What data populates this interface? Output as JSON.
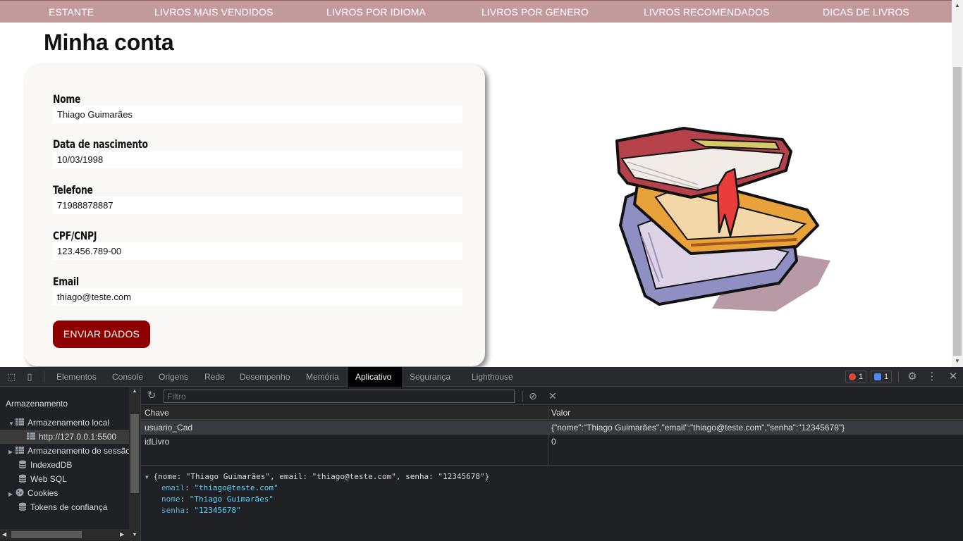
{
  "nav": {
    "items": [
      "ESTANTE",
      "LIVROS MAIS VENDIDOS",
      "LIVROS POR IDIOMA",
      "LIVROS POR GENERO",
      "LIVROS RECOMENDADOS",
      "DICAS DE LIVROS"
    ]
  },
  "page": {
    "title": "Minha conta"
  },
  "form": {
    "fields": [
      {
        "label": "Nome",
        "value": "Thiago Guimarães"
      },
      {
        "label": "Data de nascimento",
        "value": "10/03/1998"
      },
      {
        "label": "Telefone",
        "value": "71988878887"
      },
      {
        "label": "CPF/CNPJ",
        "value": "123.456.789-00"
      },
      {
        "label": "Email",
        "value": "thiago@teste.com"
      }
    ],
    "submit_label": "ENVIAR DADOS"
  },
  "devtools": {
    "tabs": [
      "Elementos",
      "Console",
      "Origens",
      "Rede",
      "Desempenho",
      "Memória",
      "Aplicativo",
      "Segurança",
      "Lighthouse"
    ],
    "active_tab": "Aplicativo",
    "error_count": "1",
    "message_count": "1",
    "sidebar": {
      "heading": "Armazenamento",
      "items": [
        {
          "label": "Armazenamento local",
          "icon": "grid-icon"
        },
        {
          "label": "http://127.0.0.1:5500",
          "icon": "grid-icon"
        },
        {
          "label": "Armazenamento de sessão",
          "icon": "grid-icon"
        },
        {
          "label": "IndexedDB",
          "icon": "database-icon"
        },
        {
          "label": "Web SQL",
          "icon": "database-icon"
        },
        {
          "label": "Cookies",
          "icon": "cookie-icon"
        },
        {
          "label": "Tokens de confiança",
          "icon": "database-icon"
        }
      ]
    },
    "filter_placeholder": "Filtro",
    "table": {
      "columns": [
        "Chave",
        "Valor"
      ],
      "rows": [
        {
          "key": "usuario_Cad",
          "value": "{\"nome\":\"Thiago Guimarães\",\"email\":\"thiago@teste.com\",\"senha\":\"12345678\"}"
        },
        {
          "key": "idLivro",
          "value": "0"
        }
      ]
    },
    "preview": {
      "summary": "{nome: \"Thiago Guimarães\", email: \"thiago@teste.com\", senha: \"12345678\"}",
      "props": [
        {
          "key": "email",
          "value": "\"thiago@teste.com\""
        },
        {
          "key": "nome",
          "value": "\"Thiago Guimarães\""
        },
        {
          "key": "senha",
          "value": "\"12345678\""
        }
      ]
    }
  }
}
